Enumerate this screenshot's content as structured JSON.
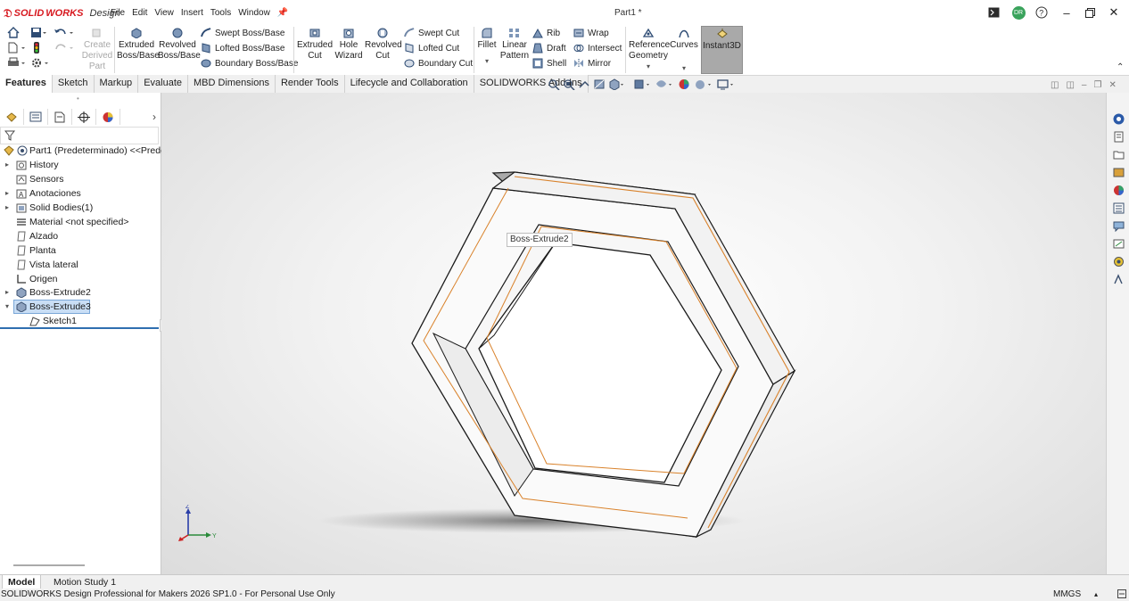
{
  "app": {
    "brand_prefix": "SOLID",
    "brand_suffix": "WORKS",
    "brand_edition": "Design",
    "document_title": "Part1 *"
  },
  "menu": [
    "File",
    "Edit",
    "View",
    "Insert",
    "Tools",
    "Window"
  ],
  "user_initials": "DR",
  "quick_access": {
    "create_derived_part": "Create Derived Part"
  },
  "ribbon": {
    "extruded_boss": "Extruded Boss/Base",
    "revolved_boss": "Revolved Boss/Base",
    "swept_boss": "Swept Boss/Base",
    "lofted_boss": "Lofted Boss/Base",
    "boundary_boss": "Boundary Boss/Base",
    "extruded_cut": "Extruded Cut",
    "hole_wizard": "Hole Wizard",
    "revolved_cut": "Revolved Cut",
    "swept_cut": "Swept Cut",
    "lofted_cut": "Lofted Cut",
    "boundary_cut": "Boundary Cut",
    "fillet": "Fillet",
    "linear_pattern": "Linear Pattern",
    "rib": "Rib",
    "draft": "Draft",
    "shell": "Shell",
    "wrap": "Wrap",
    "intersect": "Intersect",
    "mirror": "Mirror",
    "reference_geometry": "Reference Geometry",
    "curves": "Curves",
    "instant3d": "Instant3D"
  },
  "tabs": [
    "Features",
    "Sketch",
    "Markup",
    "Evaluate",
    "MBD Dimensions",
    "Render Tools",
    "Lifecycle and Collaboration",
    "SOLIDWORKS Add-Ins"
  ],
  "active_tab": "Features",
  "tree": {
    "root": "Part1 (Predeterminado) <<Prede",
    "items": [
      {
        "label": "History",
        "expandable": true
      },
      {
        "label": "Sensors",
        "expandable": false
      },
      {
        "label": "Anotaciones",
        "expandable": true
      },
      {
        "label": "Solid Bodies(1)",
        "expandable": true
      },
      {
        "label": "Material <not specified>",
        "expandable": false
      },
      {
        "label": "Alzado",
        "expandable": false
      },
      {
        "label": "Planta",
        "expandable": false
      },
      {
        "label": "Vista lateral",
        "expandable": false
      },
      {
        "label": "Origen",
        "expandable": false
      },
      {
        "label": "Boss-Extrude2",
        "expandable": true
      },
      {
        "label": "Boss-Extrude3",
        "expandable": true,
        "selected": true
      },
      {
        "label": "Sketch1",
        "expandable": false,
        "child": true
      }
    ]
  },
  "tooltip": "Boss-Extrude2",
  "bottom_tabs": [
    "Model",
    "Motion Study 1"
  ],
  "status": {
    "text": "SOLIDWORKS Design Professional for Makers 2026 SP1.0 - For Personal Use Only",
    "units": "MMGS"
  },
  "colors": {
    "brand_red": "#d71920",
    "selection": "#c9def5",
    "edge_highlight": "#d9822b"
  }
}
